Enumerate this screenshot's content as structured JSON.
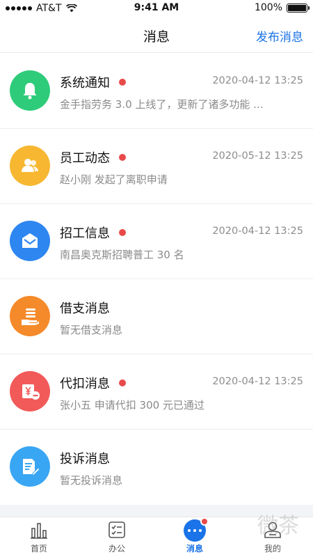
{
  "status_bar": {
    "carrier": "AT&T",
    "time": "9:41 AM",
    "battery": "100%"
  },
  "nav": {
    "title": "消息",
    "action": "发布消息"
  },
  "messages": [
    {
      "title": "系统通知",
      "unread": true,
      "time": "2020-04-12 13:25",
      "subtitle": "金手指劳务 3.0 上线了，更新了诸多功能 ...",
      "icon": "bell-icon",
      "color": "#2ecc7a"
    },
    {
      "title": "员工动态",
      "unread": true,
      "time": "2020-05-12 13:25",
      "subtitle": "赵小刚 发起了离职申请",
      "icon": "people-icon",
      "color": "#f7b731"
    },
    {
      "title": "招工信息",
      "unread": true,
      "time": "2020-04-12 13:25",
      "subtitle": "南昌奥克斯招聘普工 30 名",
      "icon": "envelope-icon",
      "color": "#2e86f0"
    },
    {
      "title": "借支消息",
      "unread": false,
      "time": "",
      "subtitle": "暂无借支消息",
      "icon": "hand-coin-icon",
      "color": "#f58a2a"
    },
    {
      "title": "代扣消息",
      "unread": true,
      "time": "2020-04-12 13:25",
      "subtitle": "张小五 申请代扣 300 元已通过",
      "icon": "yuan-minus-icon",
      "color": "#f25a5a"
    },
    {
      "title": "投诉消息",
      "unread": false,
      "time": "",
      "subtitle": "暂无投诉消息",
      "icon": "document-edit-icon",
      "color": "#39a6f3"
    }
  ],
  "tabs": [
    {
      "label": "首页",
      "icon": "bar-chart-icon"
    },
    {
      "label": "办公",
      "icon": "checklist-icon"
    },
    {
      "label": "消息",
      "icon": "message-bubble-icon",
      "active": true
    },
    {
      "label": "我的",
      "icon": "user-icon"
    }
  ],
  "watermark": "微茶"
}
